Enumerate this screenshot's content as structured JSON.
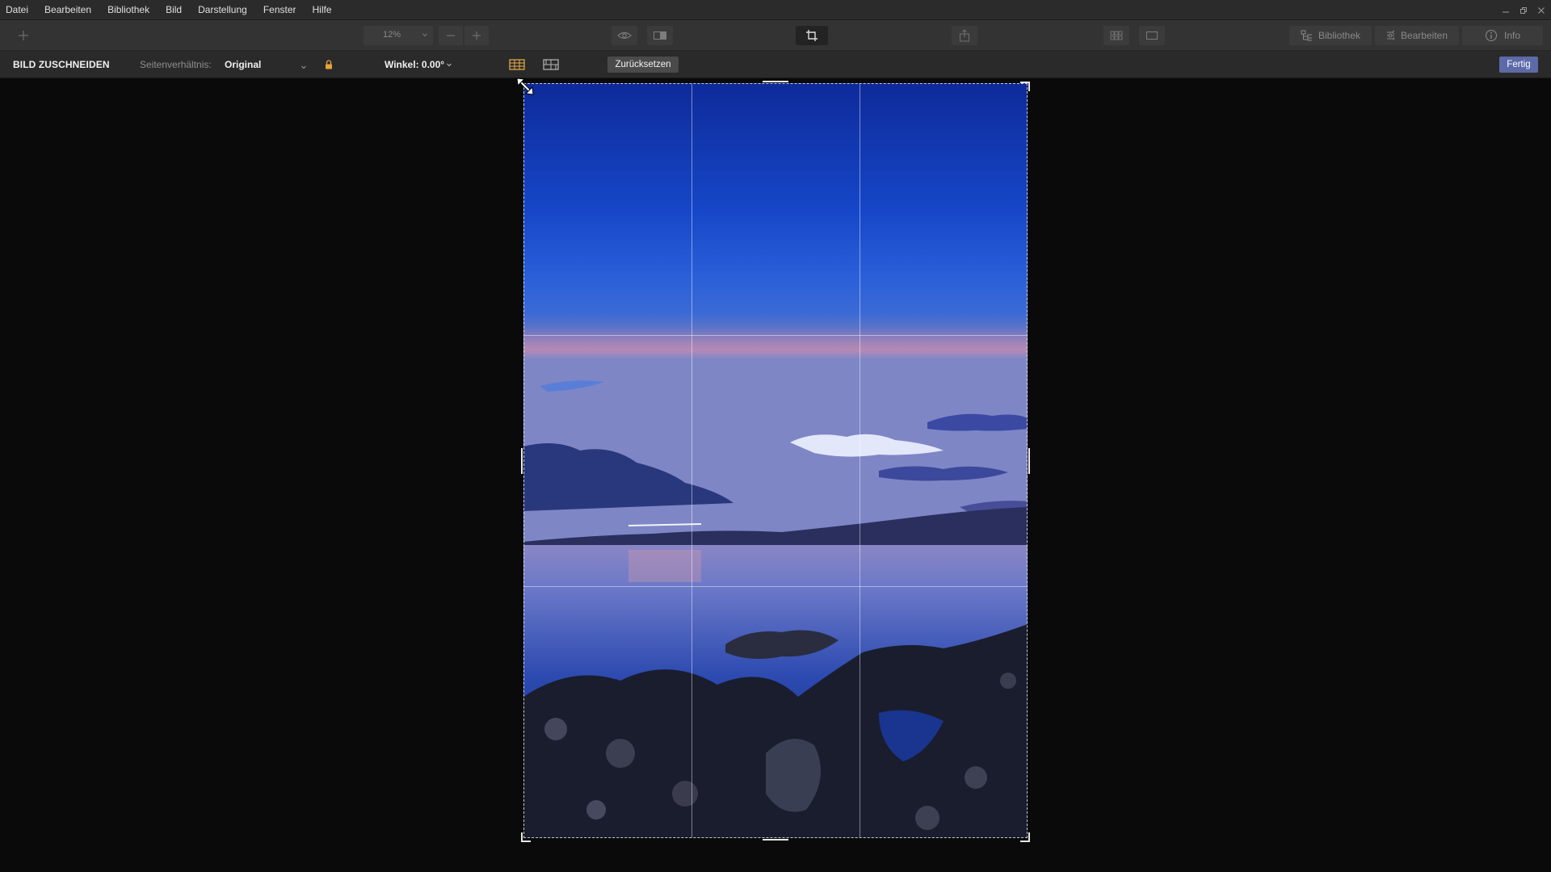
{
  "menu": {
    "items": [
      "Datei",
      "Bearbeiten",
      "Bibliothek",
      "Bild",
      "Darstellung",
      "Fenster",
      "Hilfe"
    ]
  },
  "toolbar": {
    "zoom_value": "12%",
    "panels": {
      "library": "Bibliothek",
      "edit": "Bearbeiten",
      "info": "Info"
    }
  },
  "cropbar": {
    "title": "BILD ZUSCHNEIDEN",
    "ratio_label": "Seitenverhältnis:",
    "ratio_value": "Original",
    "angle": "Winkel: 0.00°",
    "reset_label": "Zurücksetzen",
    "done_label": "Fertig"
  },
  "icons": {
    "add": "plus-icon",
    "zoom_out": "minus-icon",
    "zoom_in": "plus-icon",
    "preview": "eye-icon",
    "compare": "split-view-icon",
    "crop": "crop-icon",
    "share": "share-icon",
    "grid_view": "grid-view-icon",
    "single_view": "single-view-icon",
    "lock": "lock-icon",
    "cursor": "diagonal-resize-cursor-icon"
  },
  "colors": {
    "accent": "#5d6aa8",
    "lock": "#e8a33d",
    "grid_icon": "#e8b04a"
  }
}
